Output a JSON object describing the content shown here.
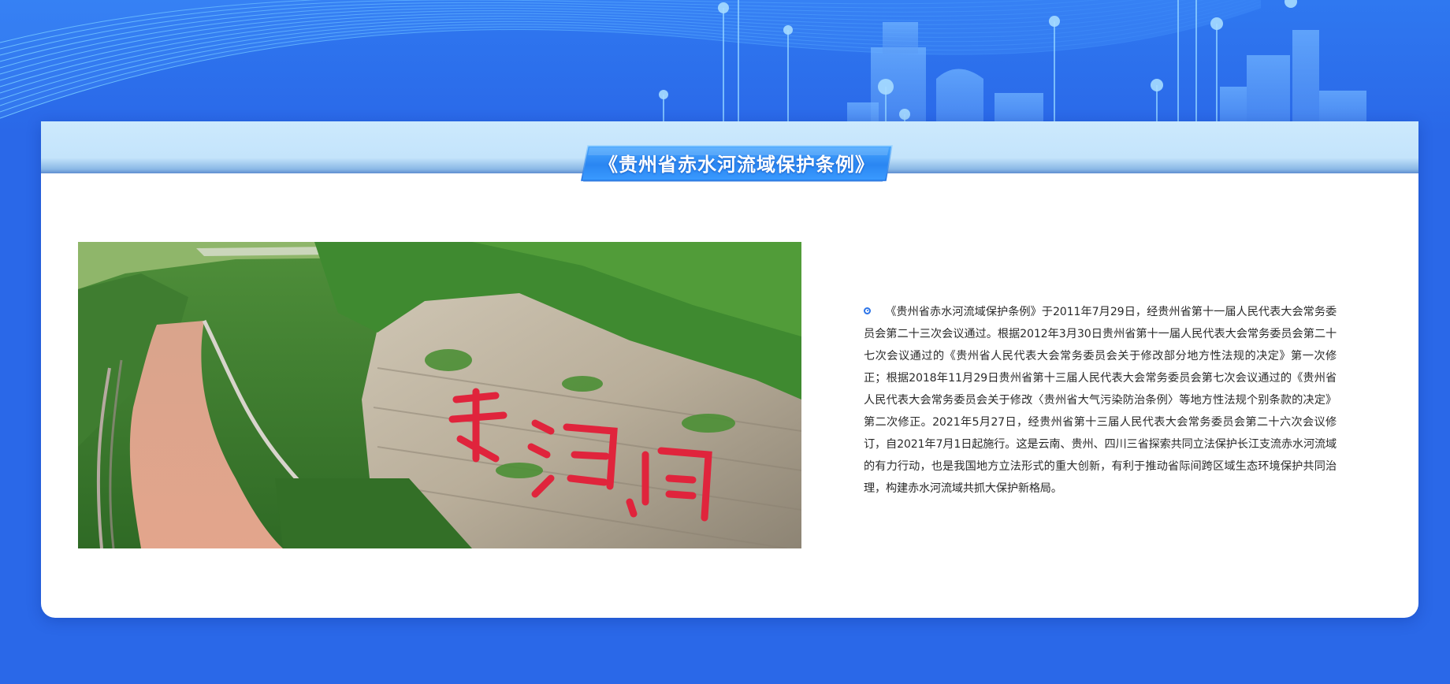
{
  "banner": {
    "title": "《贵州省赤水河流域保护条例》"
  },
  "content": {
    "paragraph": "《贵州省赤水河流域保护条例》于2011年7月29日，经贵州省第十一届人民代表大会常务委员会第二十三次会议通过。根据2012年3月30日贵州省第十一届人民代表大会常务委员会第二十七次会议通过的《贵州省人民代表大会常务委员会关于修改部分地方性法规的决定》第一次修正；根据2018年11月29日贵州省第十三届人民代表大会常务委员会第七次会议通过的《贵州省人民代表大会常务委员会关于修改〈贵州省大气污染防治条例〉等地方性法规个别条款的决定》第二次修正。2021年5月27日，经贵州省第十三届人民代表大会常务委员会第二十六次会议修订，自2021年7月1日起施行。这是云南、贵州、四川三省探索共同立法保护长江支流赤水河流域的有力行动，也是我国地方立法形式的重大创新，有利于推动省际间跨区域生态环境保护共同治理，构建赤水河流域共抓大保护新格局。"
  },
  "colors": {
    "background": "#2a68e8",
    "header_band": "#c4e4fb",
    "title_badge": "#2f8ef5",
    "bullet": "#2c74e8"
  },
  "icons": {
    "bullet": "radio-dot-icon"
  }
}
